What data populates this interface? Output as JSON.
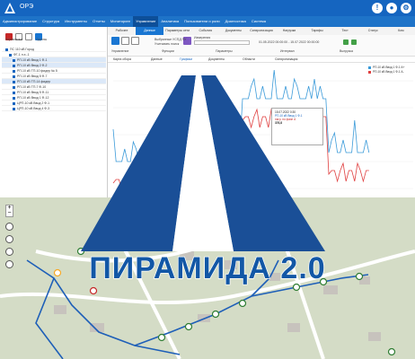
{
  "app": {
    "title": "ОРЭ"
  },
  "menu": [
    "Администрирование",
    "Структура",
    "Инструменты",
    "Отчеты",
    "Мониторинг",
    "Управление",
    "Аналитика",
    "Пользователи и роли",
    "Диагностика",
    "Система"
  ],
  "menu_active": 5,
  "left": {
    "headers": [
      "Управление",
      "Группы"
    ],
    "tree": [
      "ПС 110 кВ Город",
      "ФГ-1 л.э.-1",
      "РП-10 кВ Ввод 1 Ф-1",
      "РП-10 кВ Ввод 2 Ф-2",
      "РП-10 кВ ТП-10 фидер № 5",
      "РП-10 кВ Ввод 5 Ф-7",
      "РП-10 кВ ТП-14 фидер",
      "РП-10 кВ ТП-7 Ф-10",
      "РП-10 кВ Ввод 5 Ф-11",
      "РП-10 кВ Ввод 1 Ф-12",
      "ЦРП-10 кВ Ввод 2 Ф-1",
      "ЦРП-10 кВ Ввод 4 Ф-3"
    ]
  },
  "tabs": [
    "Рабочее",
    "Данные",
    "Параметры сети",
    "События",
    "Документы",
    "Синхронизация",
    "Нагрузки",
    "Тарифы",
    "Тест",
    "Статус",
    "Ком"
  ],
  "tabs_active": 1,
  "toolbar": {
    "labels": [
      "Управление",
      "Функции",
      "Параметры",
      "Интервал",
      "Выгрузка"
    ],
    "check1": "Выбранные УСПД ПУ",
    "check2": "Учитывать поиск",
    "device": "Измерения",
    "range": "01.05.2022 00:00:00 - 15.07.2022 00:00:00"
  },
  "subtabs": [
    "Карта сбора",
    "Данные",
    "Графики",
    "Документы",
    "Области",
    "Синхронизация"
  ],
  "subtabs_active": 2,
  "chart_data": {
    "type": "line",
    "series": [
      {
        "name": "РП-10 кВ Ввод 1 Ф-1 А+",
        "color": "#3a9ad9"
      },
      {
        "name": "РП-10 кВ Ввод 1 Ф-1 А-",
        "color": "#e04040"
      }
    ],
    "tooltip": [
      "15.07.2022 0:30",
      "РП-10 кВ Ввод 1 Ф-1",
      "нагр. по фазе А",
      "376,8"
    ]
  },
  "brand": {
    "text": "ПИРАМИДА 2.0",
    "color": "#1257a6"
  },
  "colors": {
    "header": "#1565c0",
    "menu": "#1e73c8",
    "map_bg": "#d4dcc6",
    "road": "#ffffff",
    "line": "#1e5fb8"
  }
}
